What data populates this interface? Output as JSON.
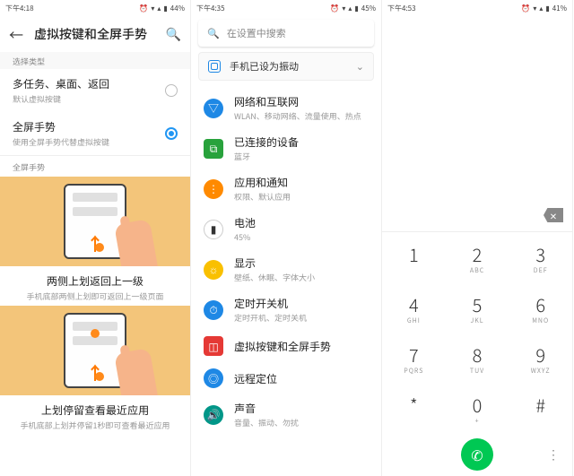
{
  "panel1": {
    "status": {
      "time": "下午4:18",
      "battery": "44%"
    },
    "title": "虚拟按键和全屏手势",
    "section_label": "选择类型",
    "opt1": {
      "title": "多任务、桌面、返回",
      "sub": "默认虚拟按键"
    },
    "opt2": {
      "title": "全屏手势",
      "sub": "使用全屏手势代替虚拟按键"
    },
    "gesture_label": "全屏手势",
    "cap1": {
      "title": "两侧上划返回上一级",
      "sub": "手机底部两侧上划即可返回上一级页面"
    },
    "cap2": {
      "title": "上划停留查看最近应用",
      "sub": "手机底部上划并停留1秒即可查看最近应用"
    }
  },
  "panel2": {
    "status": {
      "time": "下午4:35",
      "battery": "45%"
    },
    "search_placeholder": "在设置中搜索",
    "banner": "手机已设为振动",
    "items": [
      {
        "title": "网络和互联网",
        "sub": "WLAN、移动网络、流量使用、热点",
        "color": "#1e88e5",
        "glyph": "▽",
        "shape": "round"
      },
      {
        "title": "已连接的设备",
        "sub": "蓝牙",
        "color": "#28a23c",
        "glyph": "⧉",
        "shape": "sq"
      },
      {
        "title": "应用和通知",
        "sub": "权限、默认应用",
        "color": "#ff8a00",
        "glyph": "⋮⋮⋮",
        "shape": "round"
      },
      {
        "title": "电池",
        "sub": "45%",
        "color": "#ffffff",
        "glyph": "▮",
        "shape": "round",
        "fg": "#333",
        "border": "#ccc"
      },
      {
        "title": "显示",
        "sub": "壁纸、休眠、字体大小",
        "color": "#f9c000",
        "glyph": "☼",
        "shape": "round"
      },
      {
        "title": "定时开关机",
        "sub": "定时开机、定时关机",
        "color": "#1e88e5",
        "glyph": "⏱",
        "shape": "round"
      },
      {
        "title": "虚拟按键和全屏手势",
        "sub": "",
        "color": "#e53935",
        "glyph": "◫",
        "shape": "sq"
      },
      {
        "title": "远程定位",
        "sub": "",
        "color": "#1e88e5",
        "glyph": "◎",
        "shape": "round"
      },
      {
        "title": "声音",
        "sub": "音量、振动、勿扰",
        "color": "#009688",
        "glyph": "🔊",
        "shape": "round"
      }
    ]
  },
  "panel3": {
    "status": {
      "time": "下午4:53",
      "battery": "41%"
    },
    "keys": [
      [
        {
          "n": "1",
          "l": ""
        },
        {
          "n": "2",
          "l": "ABC"
        },
        {
          "n": "3",
          "l": "DEF"
        }
      ],
      [
        {
          "n": "4",
          "l": "GHI"
        },
        {
          "n": "5",
          "l": "JKL"
        },
        {
          "n": "6",
          "l": "MNO"
        }
      ],
      [
        {
          "n": "7",
          "l": "PQRS"
        },
        {
          "n": "8",
          "l": "TUV"
        },
        {
          "n": "9",
          "l": "WXYZ"
        }
      ],
      [
        {
          "n": "*",
          "l": ""
        },
        {
          "n": "0",
          "l": "+"
        },
        {
          "n": "#",
          "l": ""
        }
      ]
    ]
  }
}
